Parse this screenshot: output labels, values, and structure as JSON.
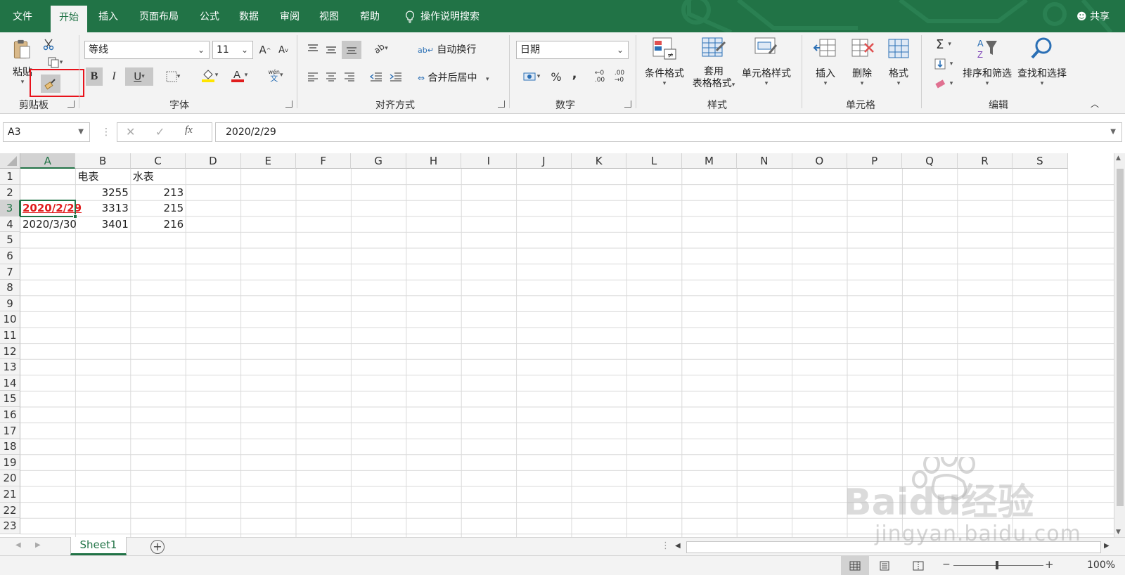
{
  "tabs": {
    "file": "文件",
    "home": "开始",
    "insert": "插入",
    "page_layout": "页面布局",
    "formulas": "公式",
    "data": "数据",
    "review": "审阅",
    "view": "视图",
    "help": "帮助",
    "search": "操作说明搜索",
    "share": "共享"
  },
  "ribbon": {
    "clipboard": {
      "paste": "粘贴",
      "group_label": "剪贴板"
    },
    "font": {
      "font_name": "等线",
      "font_size": "11",
      "group_label": "字体",
      "bold": "B",
      "italic": "I",
      "underline": "U",
      "grow": "A",
      "shrink": "A",
      "phonetic": "wén"
    },
    "alignment": {
      "wrap_text": "自动换行",
      "merge_center": "合并后居中",
      "group_label": "对齐方式"
    },
    "number": {
      "format": "日期",
      "percent": "%",
      "comma": ",",
      "group_label": "数字"
    },
    "styles": {
      "conditional": "条件格式",
      "format_table_1": "套用",
      "format_table_2": "表格格式",
      "cell_styles": "单元格样式",
      "group_label": "样式"
    },
    "cells": {
      "insert": "插入",
      "delete": "删除",
      "format": "格式",
      "group_label": "单元格"
    },
    "editing": {
      "sort_filter": "排序和筛选",
      "find_select": "查找和选择",
      "group_label": "编辑"
    }
  },
  "formula_bar": {
    "name_box": "A3",
    "formula": "2020/2/29",
    "fx": "fx"
  },
  "columns": [
    "A",
    "B",
    "C",
    "D",
    "E",
    "F",
    "G",
    "H",
    "I",
    "J",
    "K",
    "L",
    "M",
    "N",
    "O",
    "P",
    "Q",
    "R",
    "S"
  ],
  "rows": [
    "1",
    "2",
    "3",
    "4",
    "5",
    "6",
    "7",
    "8",
    "9",
    "10",
    "11",
    "12",
    "13",
    "14",
    "15",
    "16",
    "17",
    "18",
    "19",
    "20",
    "21",
    "22",
    "23"
  ],
  "cells": {
    "B1": "电表",
    "C1": "水表",
    "B2": "3255",
    "C2": "213",
    "A3": "2020/2/29",
    "B3": "3313",
    "C3": "215",
    "A4": "2020/3/30",
    "B4": "3401",
    "C4": "216"
  },
  "sheets": {
    "active": "Sheet1"
  },
  "status": {
    "zoom": "100%"
  },
  "watermark": {
    "brand": "Baidu经验",
    "url": "jingyan.baidu.com"
  },
  "colors": {
    "accent": "#217346",
    "highlight_box": "#e8121b",
    "red_text": "#e01d1d"
  }
}
